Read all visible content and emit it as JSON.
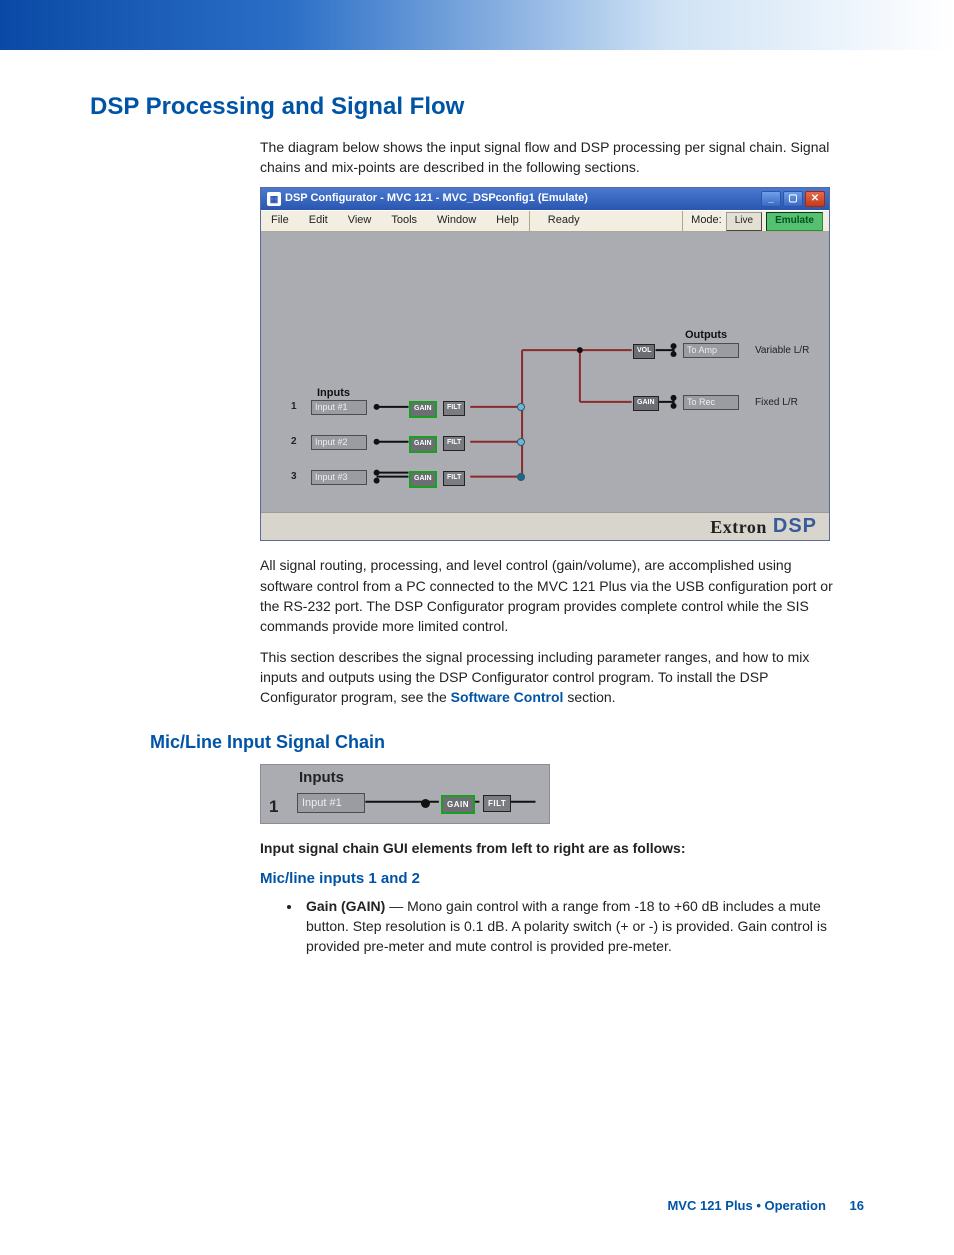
{
  "heading_main": "DSP Processing and Signal Flow",
  "intro": "The diagram below shows the input signal flow and DSP processing per signal chain. Signal chains and mix-points are described in the following sections.",
  "window": {
    "title": "DSP Configurator - MVC 121 - MVC_DSPconfig1 (Emulate)",
    "menus": [
      "File",
      "Edit",
      "View",
      "Tools",
      "Window",
      "Help"
    ],
    "status": "Ready",
    "mode_label": "Mode:",
    "mode_live": "Live",
    "mode_emulate": "Emulate",
    "inputs_header": "Inputs",
    "outputs_header": "Outputs",
    "inputs": [
      {
        "num": "1",
        "label": "Input #1"
      },
      {
        "num": "2",
        "label": "Input #2"
      },
      {
        "num": "3",
        "label": "Input #3"
      }
    ],
    "outputs": [
      {
        "label": "To Amp",
        "desc": "Variable L/R"
      },
      {
        "label": "To Rec",
        "desc": "Fixed L/R"
      }
    ],
    "block_gain": "GAIN",
    "block_filt": "FILT",
    "block_vol": "VOL",
    "brand1": "Extron",
    "brand2": "DSP"
  },
  "para_after1": "All signal routing, processing, and level control (gain/volume), are accomplished using software control from a PC connected to the MVC 121 Plus via the USB configuration port or the RS-232 port. The DSP Configurator program provides complete control while the SIS commands provide more limited control.",
  "para_after2_a": "This section describes the signal processing including parameter ranges, and how to mix inputs and outputs using the DSP Configurator control program. To install the DSP Configurator program, see the ",
  "para_after2_link": "Software Control",
  "para_after2_b": " section.",
  "h2_mic": "Mic/Line Input Signal Chain",
  "inset": {
    "header": "Inputs",
    "num": "1",
    "label": "Input #1",
    "gain": "GAIN",
    "filt": "FILT"
  },
  "lead_strong": "Input signal chain GUI elements from left to right are as follows:",
  "h3_sub": "Mic/line inputs 1 and 2",
  "bullet1_strong": "Gain (GAIN)",
  "bullet1_rest": " — Mono gain control with a range from -18 to +60 dB includes a mute button. Step resolution is 0.1 dB. A polarity switch (+ or -) is provided. Gain control is provided pre-meter and mute control is provided pre-meter.",
  "footer_doc": "MVC 121 Plus • Operation",
  "footer_page": "16"
}
